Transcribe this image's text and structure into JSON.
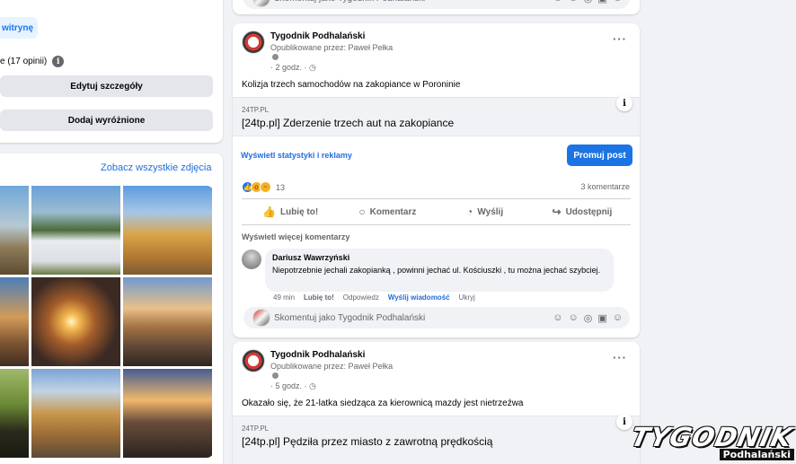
{
  "left": {
    "vitrine_label": "witrynę",
    "rating_text": "e (17 opinii)",
    "info_icon": "i",
    "edit_details_label": "Edytuj szczegóły",
    "add_featured_label": "Dodaj wyróżnione",
    "see_all_photos_label": "Zobacz wszystkie zdjęcia"
  },
  "comment_placeholder": "Skomentuj jako Tygodnik Podhalański",
  "comment_icons": [
    "☺",
    "☺",
    "◎",
    "▣",
    "☺"
  ],
  "posts": [
    {
      "page_name": "Tygodnik Podhalański",
      "published_by": "Opublikowane przez: Paweł Pełka",
      "time": "· 2 godz. ·",
      "text": "Kolizja trzech samochodów na zakopiance w Poroninie",
      "link_domain": "24TP.PL",
      "link_title": "[24tp.pl] Zderzenie trzech aut na zakopiance",
      "stats_label": "Wyświetl statystyki i reklamy",
      "promote_label": "Promuj post",
      "reaction_count": "13",
      "comment_count": "3 komentarze",
      "actions": {
        "like": "Lubię to!",
        "comment": "Komentarz",
        "send": "Wyślij",
        "share": "Udostępnij"
      },
      "view_more_comments": "Wyświetl więcej komentarzy",
      "comment": {
        "author": "Dariusz Wawrzyński",
        "text": "Niepotrzebnie jechali zakopianką , powinni jechać ul. Kościuszki , tu można jechać szybciej.",
        "time": "49 min",
        "like": "Lubię to!",
        "reply": "Odpowiedz",
        "send_message": "Wyślij wiadomość",
        "hide": "Ukryj"
      }
    },
    {
      "page_name": "Tygodnik Podhalański",
      "published_by": "Opublikowane przez: Paweł Pełka",
      "time": "· 5 godz. ·",
      "text": "Okazało się, że 21-latka siedząca za kierownicą mazdy jest nietrzeźwa",
      "link_domain": "24TP.PL",
      "link_title": "[24tp.pl] Pędziła przez miasto z zawrotną prędkością"
    }
  ],
  "watermark": {
    "main": "TYGODNIK",
    "sub": "Podhalański"
  }
}
